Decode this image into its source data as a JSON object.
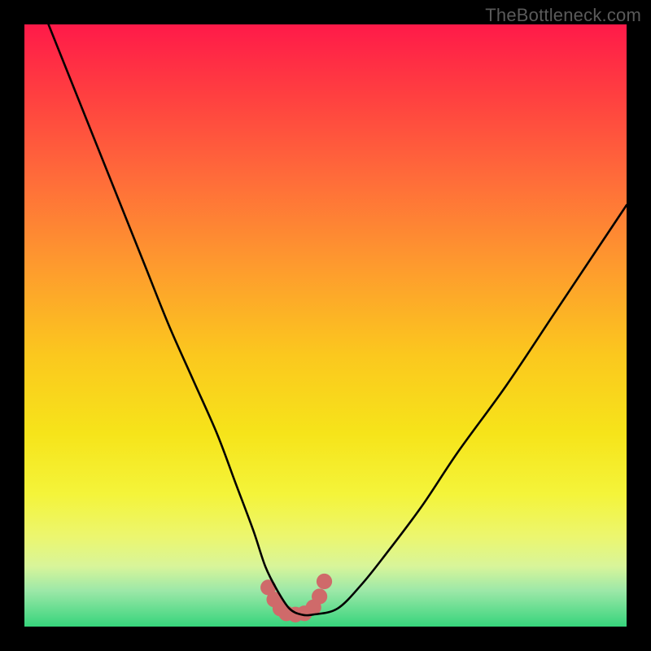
{
  "watermark": "TheBottleneck.com",
  "colors": {
    "frame": "#000000",
    "curve_stroke": "#000000",
    "marker_fill": "#cf6a6a",
    "gradient_top": "#ff1a49",
    "gradient_bottom": "#36d47c"
  },
  "chart_data": {
    "type": "line",
    "title": "",
    "xlabel": "",
    "ylabel": "",
    "xlim": [
      0,
      100
    ],
    "ylim": [
      0,
      100
    ],
    "note": "No axis ticks or numeric labels are visible; x/y values are estimated positions on a 0–100 normalized scale read from the plot area.",
    "series": [
      {
        "name": "curve",
        "x": [
          4,
          8,
          12,
          16,
          20,
          24,
          28,
          32,
          35,
          38,
          40,
          42,
          44,
          46,
          48,
          52,
          56,
          60,
          66,
          72,
          80,
          88,
          96,
          100
        ],
        "y": [
          100,
          90,
          80,
          70,
          60,
          50,
          41,
          32,
          24,
          16,
          10,
          6,
          3,
          2,
          2,
          3,
          7,
          12,
          20,
          29,
          40,
          52,
          64,
          70
        ]
      }
    ],
    "markers": {
      "name": "bottom-cluster",
      "x": [
        40.5,
        41.5,
        42.5,
        43.5,
        45.0,
        46.5,
        48.0,
        49.0,
        49.8
      ],
      "y": [
        6.5,
        4.5,
        3.0,
        2.2,
        2.0,
        2.2,
        3.2,
        5.0,
        7.5
      ]
    }
  }
}
